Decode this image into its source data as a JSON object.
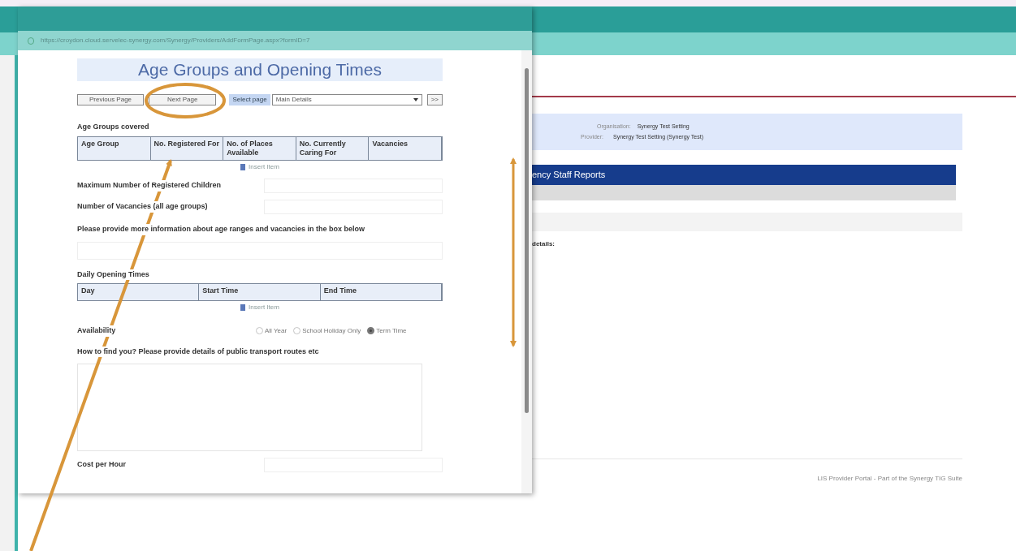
{
  "background_page": {
    "organisation_label": "Organisation:",
    "organisation": "Synergy Test Setting",
    "provider_label": "Provider:",
    "provider": "Synergy Test Setting (Synergy Test)",
    "menu_bar_title": "ency Staff Reports",
    "details_label": "details:",
    "footer": "LIS Provider Portal - Part of the Synergy TIG Suite"
  },
  "popup": {
    "url": "https://croydon.cloud.servelec-synergy.com/Synergy/Providers/AddFormPage.aspx?formID=7",
    "heading": "Age Groups and Opening Times",
    "nav": {
      "previous": "Previous Page",
      "next": "Next Page",
      "select_label": "Select page",
      "select_value": "Main Details",
      "go": ">>"
    },
    "sections": [
      {
        "kind": "table",
        "title": "Age Groups covered",
        "columns": [
          "Age Group",
          "No. Registered For",
          "No. of Places Available",
          "No. Currently Caring For",
          "Vacancies"
        ],
        "insert": "Insert Item"
      },
      {
        "kind": "field",
        "label": "Maximum Number of Registered Children"
      },
      {
        "kind": "field",
        "label": "Number of Vacancies (all age groups)"
      },
      {
        "kind": "memo",
        "label": "Please provide more information about age ranges and vacancies in the box below"
      },
      {
        "kind": "table",
        "title": "Daily Opening Times",
        "columns": [
          "Day",
          "Start Time",
          "End Time"
        ],
        "insert": "Insert Item"
      },
      {
        "kind": "radio",
        "label": "Availability",
        "options": [
          {
            "label": "All Year",
            "selected": false
          },
          {
            "label": "School Holiday Only",
            "selected": false
          },
          {
            "label": "Term Time",
            "selected": true
          }
        ]
      },
      {
        "kind": "textarea",
        "label": "How to find you? Please provide details of public transport routes etc"
      },
      {
        "kind": "field",
        "label": "Cost per Hour"
      }
    ]
  }
}
